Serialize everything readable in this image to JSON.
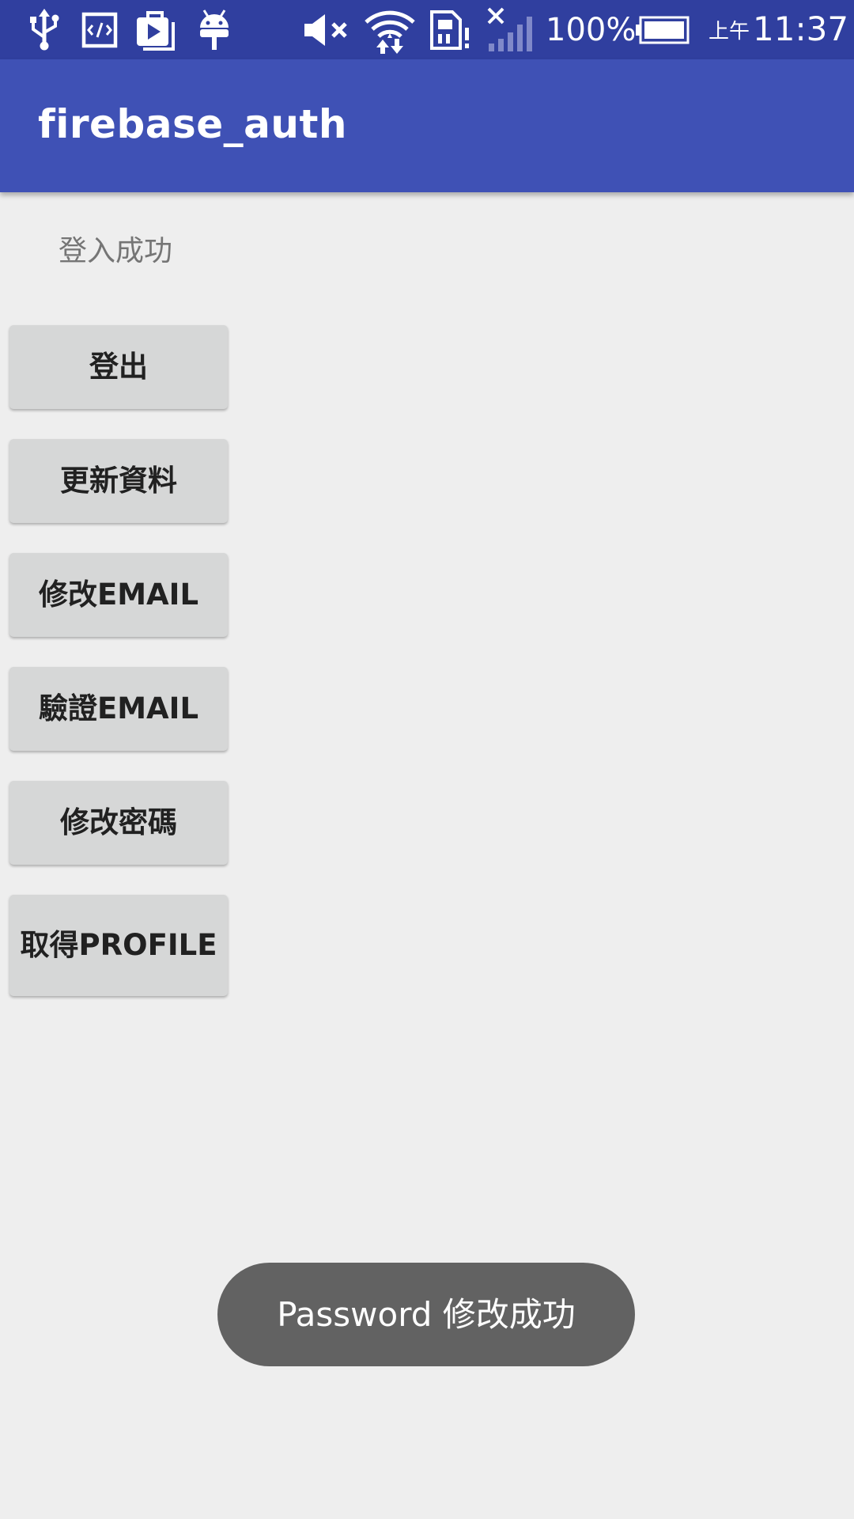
{
  "status_bar": {
    "icons": [
      "usb-icon",
      "developer-mode-icon",
      "media-icon",
      "android-debug-icon",
      "volume-muted-icon",
      "wifi-icon",
      "sim-alert-icon",
      "signal-icon",
      "battery-icon"
    ],
    "battery_percent": "100%",
    "clock_period": "上午",
    "clock_time": "11:37",
    "colors": {
      "background": "#303f9f"
    }
  },
  "app_bar": {
    "title": "firebase_auth",
    "colors": {
      "background": "#3f51b5"
    }
  },
  "main": {
    "status_text": "登入成功",
    "buttons": [
      {
        "label": "登出"
      },
      {
        "label": "更新資料"
      },
      {
        "label": "修改EMAIL"
      },
      {
        "label": "驗證EMAIL"
      },
      {
        "label": "修改密碼"
      },
      {
        "label": "取得PROFILE"
      }
    ],
    "colors": {
      "background": "#eeeeee",
      "button": "#d6d7d7"
    }
  },
  "toast": {
    "message": "Password 修改成功",
    "colors": {
      "background": "#626262"
    }
  }
}
